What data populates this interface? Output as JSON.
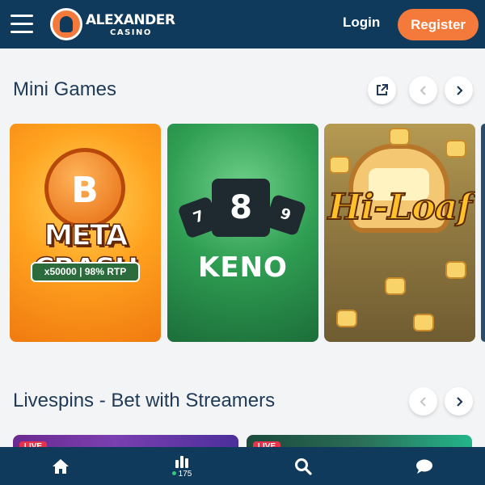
{
  "header": {
    "menu_icon": "hamburger-menu-icon",
    "logo_name": "ALEXANDER",
    "logo_sub": "CASINO",
    "login_label": "Login",
    "register_label": "Register",
    "brand_color": "#103a5c",
    "accent_color": "#f47a3c"
  },
  "mini_games": {
    "title": "Mini Games",
    "icons": [
      "external-link-icon",
      "chevron-left-icon",
      "chevron-right-icon"
    ],
    "games": [
      {
        "title": "META CRASH",
        "symbol": "B",
        "badge": "x50000  |  98% RTP"
      },
      {
        "title": "KENO",
        "tiles": [
          "7",
          "8",
          "9"
        ]
      },
      {
        "title": "Hi-Loaf"
      }
    ]
  },
  "livespins": {
    "title": "Livespins - Bet with Streamers",
    "icons": [
      "chevron-left-icon",
      "chevron-right-icon"
    ],
    "cards": [
      {
        "badge": "LIVE"
      },
      {
        "badge": "LIVE"
      }
    ]
  },
  "bottom_nav": {
    "items": [
      {
        "icon": "home-icon"
      },
      {
        "icon": "bar-chart-icon",
        "count": "175"
      },
      {
        "icon": "search-icon"
      },
      {
        "icon": "chat-icon"
      }
    ]
  }
}
